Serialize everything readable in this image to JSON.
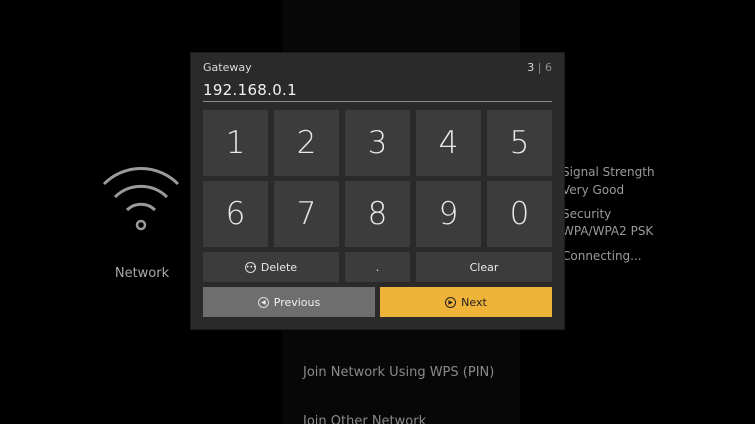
{
  "background": {
    "network_label": "Network",
    "right_details": [
      "Signal Strength",
      "Very Good",
      "Security",
      "WPA/WPA2 PSK",
      "Connecting..."
    ],
    "bottom_items": [
      "Join Network Using WPS (PIN)",
      "Join Other Network"
    ]
  },
  "dialog": {
    "title": "Gateway",
    "step_current": "3",
    "step_sep": "|",
    "step_total": "6",
    "value": "192.168.0.1",
    "digits_row1": [
      "1",
      "2",
      "3",
      "4",
      "5"
    ],
    "digits_row2": [
      "6",
      "7",
      "8",
      "9",
      "0"
    ],
    "delete_label": "Delete",
    "dot_label": ".",
    "clear_label": "Clear",
    "previous_label": "Previous",
    "next_label": "Next"
  },
  "colors": {
    "accent": "#f0b33a",
    "dialog_bg": "#2a2a2a",
    "key_bg": "#3c3c3c"
  }
}
